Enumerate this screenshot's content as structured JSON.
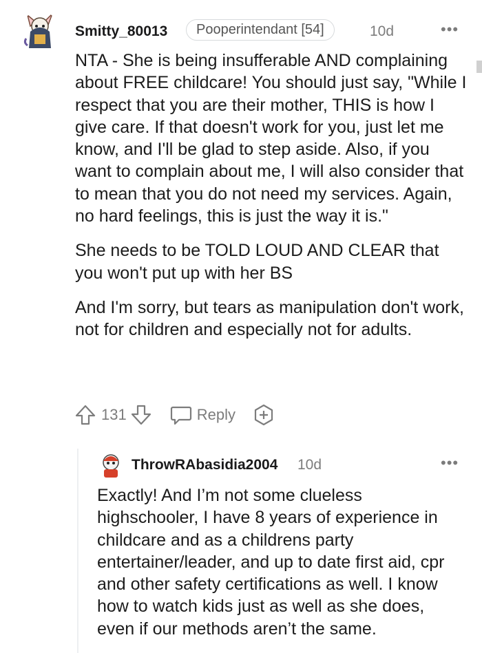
{
  "comment": {
    "username": "Smitty_80013",
    "flair": "Pooperintendant [54]",
    "time": "10d",
    "more": "•••",
    "paragraphs": [
      "NTA - She is being insufferable AND complaining about FREE childcare! You should just say, \"While I respect that you are their mother, THIS is how I give care. If that doesn't work for you, just let me know, and I'll be glad to step aside. Also, if you want to complain about me, I will also consider that to mean that you do not need my services. Again, no hard feelings, this is just the way it is.\"",
      "She needs to be TOLD LOUD AND CLEAR that you won't put up with her BS",
      "And I'm sorry, but tears as manipulation don't work, not for children and especially not for adults."
    ],
    "votes": "131",
    "reply_label": "Reply",
    "icons": {
      "upvote": "upvote-arrow-icon",
      "downvote": "downvote-arrow-icon",
      "reply": "reply-bubble-icon",
      "award": "award-plus-icon"
    }
  },
  "reply": {
    "username": "ThrowRAbasidia2004",
    "time": "10d",
    "more": "•••",
    "paragraphs": [
      "Exactly! And I’m not some clueless highschooler, I have 8 years of experience in childcare and as a childrens party entertainer/leader, and up to date first aid, cpr and other safety certifications as well. I know how to watch kids just as well as she does, even if our methods aren’t the same."
    ]
  },
  "colors": {
    "text": "#1c1c1c",
    "meta": "#7c7c7c",
    "border": "#d7dadc"
  }
}
